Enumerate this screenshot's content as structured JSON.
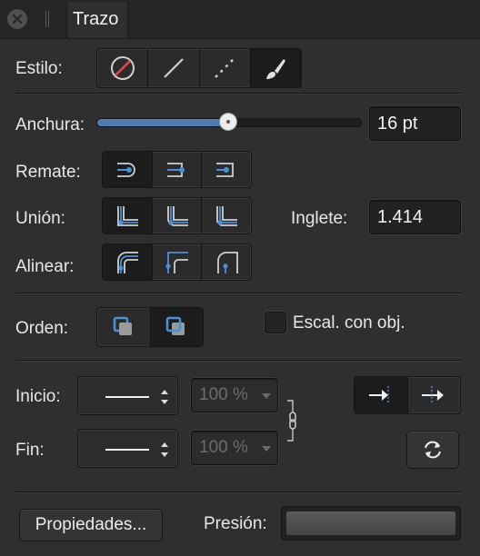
{
  "panel": {
    "tab_title": "Trazo"
  },
  "labels": {
    "style": "Estilo:",
    "width": "Anchura:",
    "cap": "Remate:",
    "join": "Unión:",
    "align": "Alinear:",
    "miter": "Inglete:",
    "order": "Orden:",
    "scale_with_object": "Escal. con obj.",
    "start": "Inicio:",
    "end": "Fin:",
    "pressure": "Presión:"
  },
  "width": {
    "value": "16 pt",
    "slider_fraction": 0.5
  },
  "miter": {
    "value": "1.414"
  },
  "start": {
    "scale": "100 %"
  },
  "end": {
    "scale": "100 %"
  },
  "buttons": {
    "properties": "Propiedades..."
  },
  "colors": {
    "accent": "#4a90d9",
    "none_red": "#d94a4a"
  }
}
